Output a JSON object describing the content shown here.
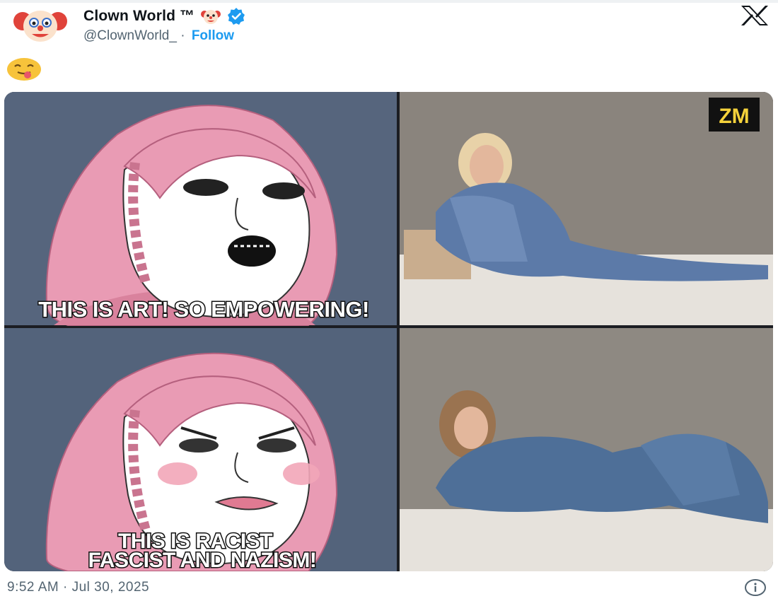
{
  "tweet": {
    "display_name": "Clown World ™",
    "handle": "@ClownWorld_",
    "separator": "·",
    "follow_label": "Follow",
    "timestamp": "9:52 AM · Jul 30, 2025",
    "verified": true
  },
  "meme": {
    "top_caption": "THIS IS ART! SO EMPOWERING!",
    "bottom_caption_line1": "THIS IS RACIST",
    "bottom_caption_line2": "FASCIST AND NAZISM!",
    "watermark": "ZM"
  },
  "icons": {
    "avatar": "clown-face-icon",
    "name_emoji": "clown-face-icon",
    "verified": "verified-badge-icon",
    "post_emoji": "face-with-tongue-icon",
    "platform": "x-logo-icon",
    "info": "info-icon"
  },
  "colors": {
    "link_blue": "#1d9bf0",
    "text_primary": "#0f1419",
    "text_secondary": "#536471",
    "meme_pink": "#e99bb4",
    "meme_bg": "#56657d"
  }
}
